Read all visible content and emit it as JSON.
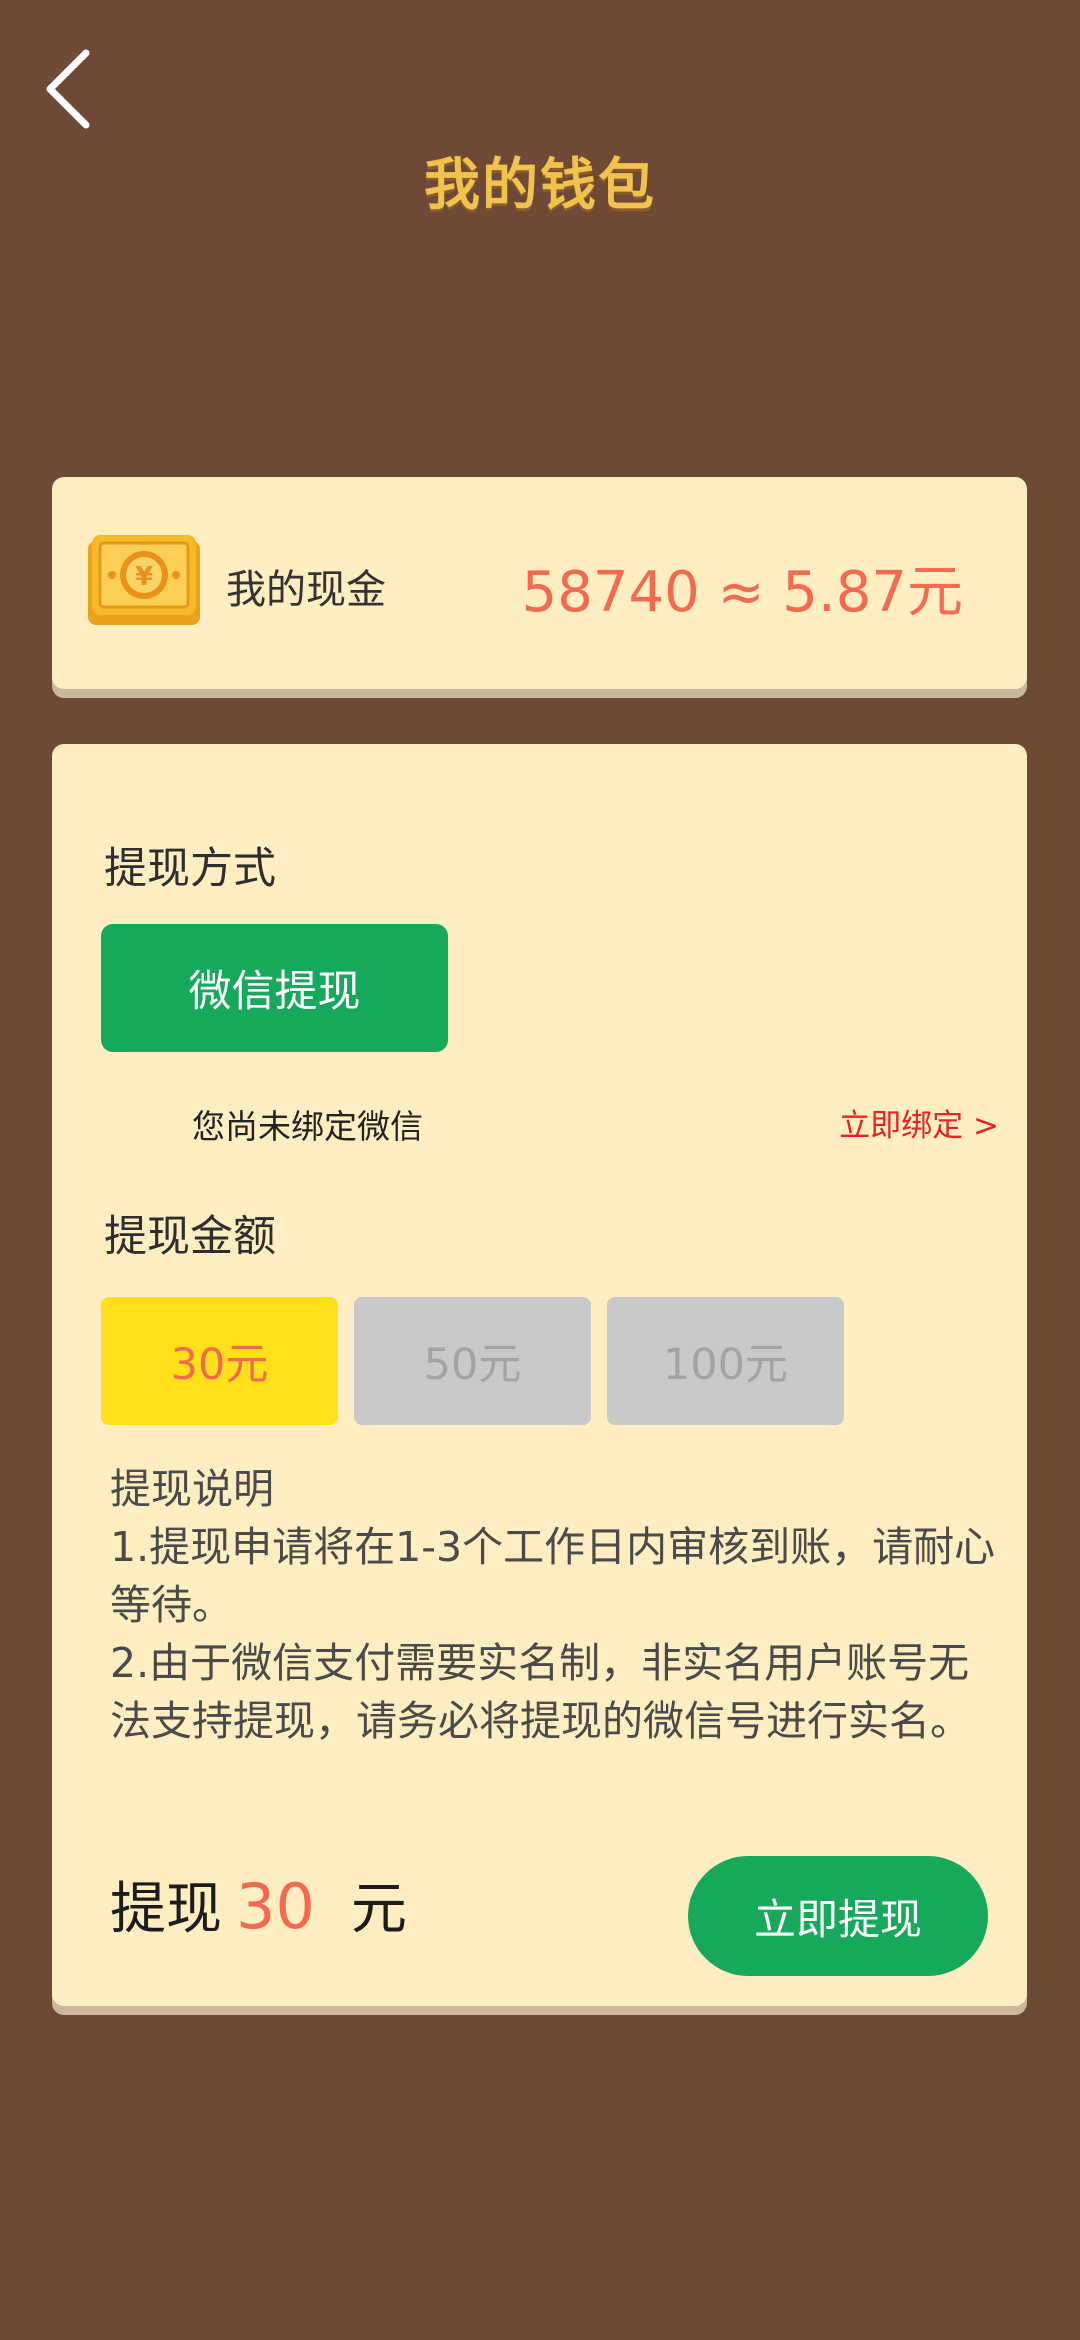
{
  "header": {
    "title": "我的钱包",
    "back_icon": "chevron-left-icon"
  },
  "cash": {
    "icon": "cash-bill-icon",
    "label": "我的现金",
    "value": "58740 ≈ 5.87元"
  },
  "withdraw_method": {
    "title": "提现方式",
    "wechat_label": "微信提现",
    "unbound_text": "您尚未绑定微信",
    "bind_link": "立即绑定 >"
  },
  "withdraw_amount": {
    "title": "提现金额",
    "options": [
      {
        "label": "30元",
        "state": "selected"
      },
      {
        "label": "50元",
        "state": "disabled"
      },
      {
        "label": "100元",
        "state": "disabled"
      }
    ]
  },
  "notes": {
    "title": "提现说明",
    "line1": "1.提现申请将在1-3个工作日内审核到账，请耐心等待。",
    "line2": "2.由于微信支付需要实名制，非实名用户账号无法支持提现，请务必将提现的微信号进行实名。"
  },
  "summary": {
    "prefix": "提现",
    "amount": "30",
    "unit": "元",
    "button_label": "立即提现"
  },
  "colors": {
    "background": "#6e4a36",
    "card": "#ffeec1",
    "accent_green": "#17a95b",
    "accent_red": "#f26a50",
    "title_gold": "#f1c24d",
    "selected_yellow": "#ffe01a",
    "disabled_gray": "#c9c9c9"
  }
}
